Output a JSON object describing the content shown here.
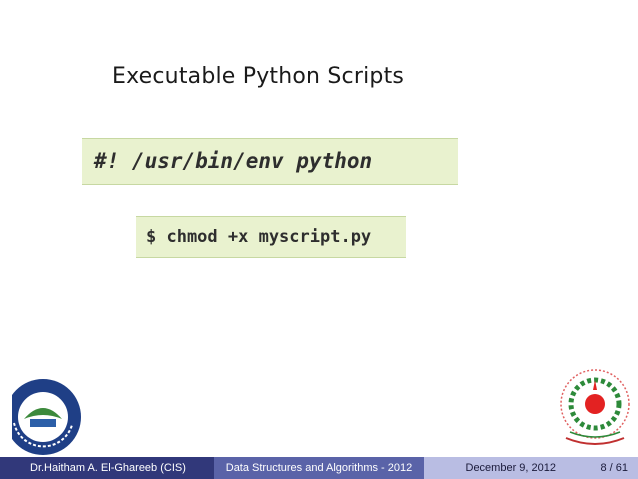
{
  "slide": {
    "title": "Executable Python Scripts"
  },
  "code": {
    "shebang": "#! /usr/bin/env python",
    "chmod": "$ chmod +x myscript.py"
  },
  "footer": {
    "author": "Dr.Haitham A. El-Ghareeb  (CIS)",
    "course": "Data Structures and Algorithms - 2012",
    "date": "December 9, 2012",
    "page": "8 / 61"
  },
  "logos": {
    "left": "faculty-logo",
    "right": "university-seal"
  },
  "colors": {
    "footer_dark": "#31387a",
    "footer_mid": "#5a63a8",
    "footer_light": "#b9bde3",
    "code_bg": "#e9f2cf"
  }
}
